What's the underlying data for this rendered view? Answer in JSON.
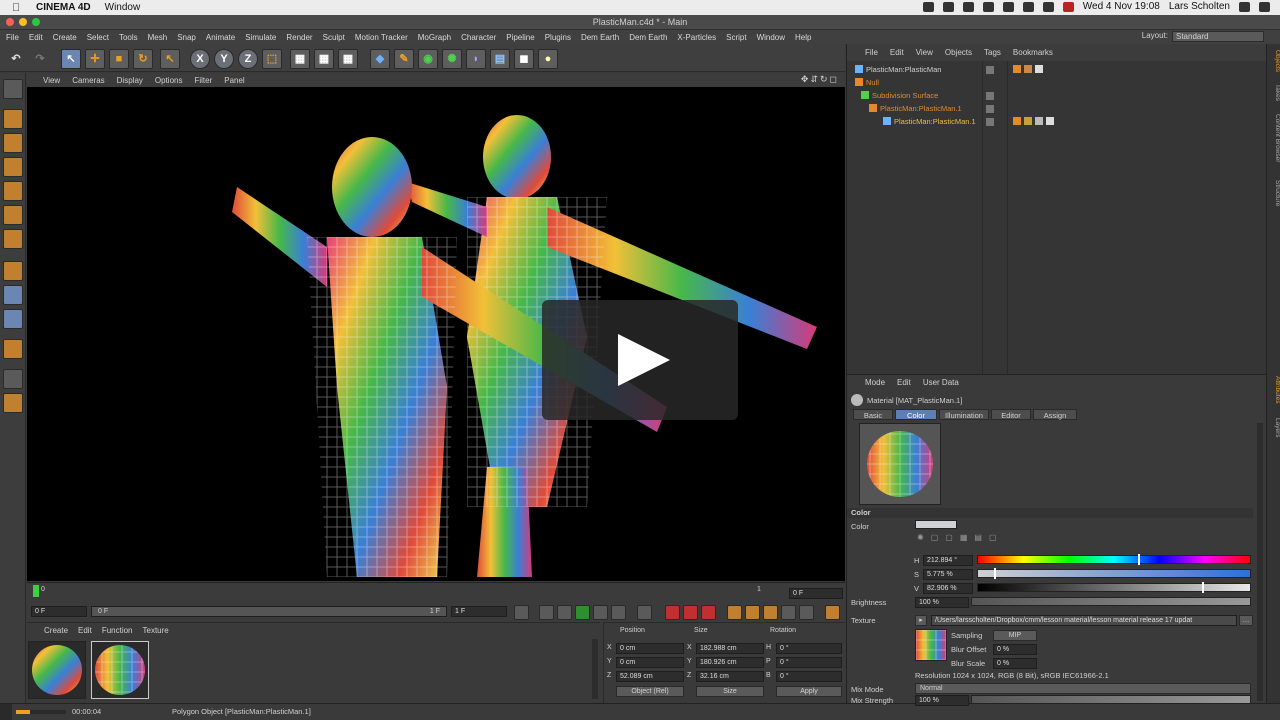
{
  "macbar": {
    "app_name": "CINEMA 4D",
    "menu_window": "Window",
    "date_time": "Wed 4 Nov  19:08",
    "user": "Lars Scholten"
  },
  "window": {
    "title": "PlasticMan.c4d * - Main"
  },
  "app_menu": {
    "items": [
      "File",
      "Edit",
      "Create",
      "Select",
      "Tools",
      "Mesh",
      "Snap",
      "Animate",
      "Simulate",
      "Render",
      "Sculpt",
      "Motion Tracker",
      "MoGraph",
      "Character",
      "Pipeline",
      "Plugins",
      "Dem Earth",
      "Dem Earth",
      "X-Particles",
      "Script",
      "Window",
      "Help"
    ],
    "layout_label": "Layout:",
    "layout_value": "Standard"
  },
  "toolbar": {
    "axis_x": "X",
    "axis_y": "Y",
    "axis_z": "Z"
  },
  "viewport": {
    "menu": [
      "View",
      "Cameras",
      "Display",
      "Options",
      "Filter",
      "Panel"
    ]
  },
  "timeline": {
    "start_frame_marker": "0",
    "end_marker": "1",
    "current_field": "0 F",
    "transport_start": "0 F",
    "transport_slider_min": "0 F",
    "transport_slider_max": "1 F",
    "transport_end": "1 F"
  },
  "material_manager": {
    "menu": [
      "Create",
      "Edit",
      "Function",
      "Texture"
    ]
  },
  "coordinates": {
    "headers": {
      "position": "Position",
      "size": "Size",
      "rotation": "Rotation"
    },
    "rows": [
      {
        "axis": "X",
        "pos": "0 cm",
        "size_axis": "X",
        "size": "182.988 cm",
        "rot_axis": "H",
        "rot": "0 °"
      },
      {
        "axis": "Y",
        "pos": "0 cm",
        "size_axis": "Y",
        "size": "180.926 cm",
        "rot_axis": "P",
        "rot": "0 °"
      },
      {
        "axis": "Z",
        "pos": "52.089 cm",
        "size_axis": "Z",
        "size": "32.16 cm",
        "rot_axis": "B",
        "rot": "0 °"
      }
    ],
    "mode": "Object (Rel)",
    "size_mode": "Size",
    "apply": "Apply"
  },
  "status": {
    "time": "00:00:04",
    "message": "Polygon Object [PlasticMan:PlasticMan.1]"
  },
  "object_manager": {
    "menu": [
      "File",
      "Edit",
      "View",
      "Objects",
      "Tags",
      "Bookmarks"
    ],
    "rows": [
      {
        "name": "PlasticMan:PlasticMan",
        "indent": 0,
        "color": "#d0d0d0"
      },
      {
        "name": "Null",
        "indent": 0,
        "color": "#e38a2c"
      },
      {
        "name": "Subdivision Surface",
        "indent": 1,
        "color": "#e38a2c"
      },
      {
        "name": "PlasticMan:PlasticMan.1",
        "indent": 2,
        "color": "#e38a2c"
      },
      {
        "name": "PlasticMan:PlasticMan.1",
        "indent": 3,
        "color": "#f0c23a"
      }
    ]
  },
  "attribute_manager": {
    "menu": [
      "Mode",
      "Edit",
      "User Data"
    ],
    "material_title": "Material [MAT_PlasticMan.1]",
    "tabs": [
      "Basic",
      "Color",
      "Illumination",
      "Editor",
      "Assign"
    ],
    "active_tab": "Color",
    "section": "Color",
    "color_label": "Color",
    "h_label": "H",
    "h_value": "212.894 °",
    "s_label": "S",
    "s_value": "5.775 %",
    "v_label": "V",
    "v_value": "82.906 %",
    "brightness_label": "Brightness",
    "brightness_value": "100 %",
    "texture_label": "Texture",
    "texture_path": "/Users/larsscholten/Dropbox/cmm/lesson material/lesson material release 17 updat",
    "sampling_label": "Sampling",
    "sampling_value": "MIP",
    "blur_offset_label": "Blur Offset",
    "blur_offset_value": "0 %",
    "blur_scale_label": "Blur Scale",
    "blur_scale_value": "0 %",
    "resolution": "Resolution 1024 x 1024, RGB (8 Bit), sRGB IEC61966-2.1",
    "mix_mode_label": "Mix Mode",
    "mix_mode_value": "Normal",
    "mix_strength_label": "Mix Strength",
    "mix_strength_value": "100 %",
    "hsv_marker": {
      "h": 212.894,
      "s": 5.775,
      "v": 82.906
    }
  },
  "right_tabs": [
    "Objects",
    "Takes",
    "Content Browser",
    "Structure"
  ],
  "right_tabs_lower": [
    "Attributes",
    "Layers"
  ]
}
